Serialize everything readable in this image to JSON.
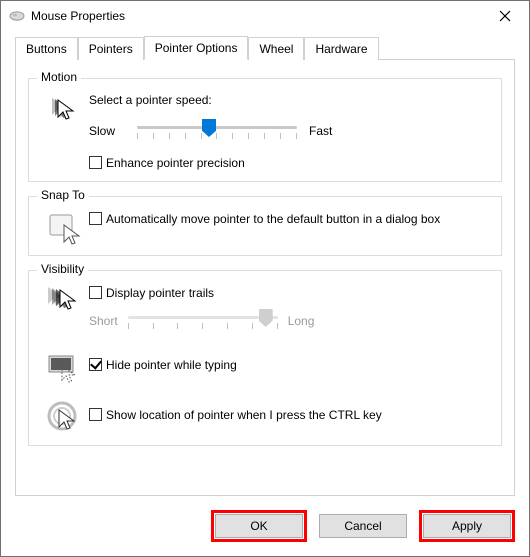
{
  "title": "Mouse Properties",
  "tabs": {
    "buttons": "Buttons",
    "pointers": "Pointers",
    "pointer_options": "Pointer Options",
    "wheel": "Wheel",
    "hardware": "Hardware"
  },
  "motion": {
    "legend": "Motion",
    "speed_label": "Select a pointer speed:",
    "slow": "Slow",
    "fast": "Fast",
    "enhance_precision": "Enhance pointer precision",
    "enhance_checked": false
  },
  "snap_to": {
    "legend": "Snap To",
    "auto_move": "Automatically move pointer to the default button in a dialog box",
    "auto_checked": false
  },
  "visibility": {
    "legend": "Visibility",
    "trails": "Display pointer trails",
    "trails_checked": false,
    "short": "Short",
    "long": "Long",
    "hide_typing": "Hide pointer while typing",
    "hide_checked": true,
    "show_ctrl": "Show location of pointer when I press the CTRL key",
    "show_ctrl_checked": false
  },
  "buttons": {
    "ok": "OK",
    "cancel": "Cancel",
    "apply": "Apply"
  }
}
